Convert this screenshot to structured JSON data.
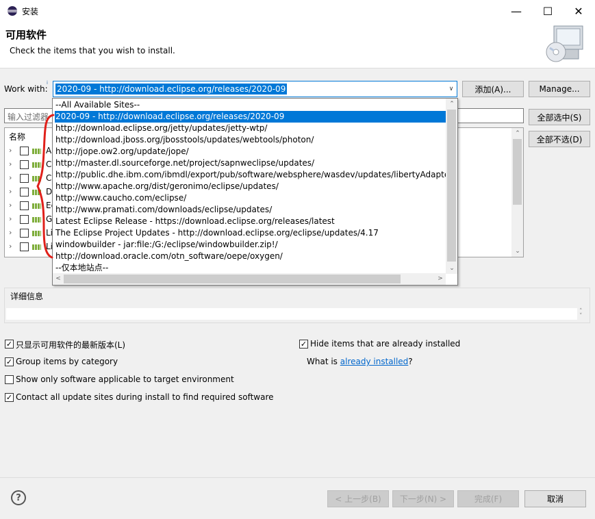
{
  "window": {
    "title": "安装",
    "minimize": "—",
    "maximize": "☐",
    "close": "✕"
  },
  "banner": {
    "title": "可用软件",
    "description": "Check the items that you wish to install."
  },
  "work_with": {
    "label": "Work with:",
    "info_marker": "i",
    "value": "2020-09 - http://download.eclipse.org/releases/2020-09",
    "arrow": "∨",
    "add_button": "添加(A)...",
    "manage_button": "Manage..."
  },
  "dropdown": {
    "items": [
      "--All Available Sites--",
      "2020-09 - http://download.eclipse.org/releases/2020-09",
      "http://download.eclipse.org/jetty/updates/jetty-wtp/",
      "http://download.jboss.org/jbosstools/updates/webtools/photon/",
      "http://jope.ow2.org/update/jope/",
      "http://master.dl.sourceforge.net/project/sapnweclipse/updates/",
      "http://public.dhe.ibm.com/ibmdl/export/pub/software/websphere/wasdev/updates/libertyAdapter/",
      "http://www.apache.org/dist/geronimo/eclipse/updates/",
      "http://www.caucho.com/eclipse/",
      "http://www.pramati.com/downloads/eclipse/updates/",
      "Latest Eclipse Release - https://download.eclipse.org/releases/latest",
      "The Eclipse Project Updates - http://download.eclipse.org/eclipse/updates/4.17",
      "windowbuilder - jar:file:/G:/eclipse/windowbuilder.zip!/",
      "http://download.oracle.com/otn_software/oepe/oxygen/",
      "--仅本地站点--"
    ],
    "selected_index": 1
  },
  "filter": {
    "placeholder": "输入过滤器"
  },
  "side_buttons": {
    "select_all": "全部选中(S)",
    "deselect_all": "全部不选(D)"
  },
  "tree": {
    "header": "名称",
    "rows": [
      "A",
      "Cl",
      "Co",
      "D",
      "Ec",
      "G",
      "Li",
      "Li"
    ]
  },
  "details": {
    "label": "详细信息"
  },
  "options": {
    "show_latest": {
      "label": "只显示可用软件的最新版本(L)",
      "checked": true
    },
    "group_by_category": {
      "label": "Group items by category",
      "checked": true
    },
    "applicable_only": {
      "label": "Show only software applicable to target environment",
      "checked": false
    },
    "contact_sites": {
      "label": "Contact all update sites during install to find required software",
      "checked": true
    },
    "hide_installed": {
      "label": "Hide items that are already installed",
      "checked": true
    },
    "what_is_prefix": "What is ",
    "what_is_link": "already installed",
    "what_is_suffix": "?"
  },
  "footer": {
    "help": "?",
    "back": "< 上一步(B)",
    "next": "下一步(N) >",
    "finish": "完成(F)",
    "cancel": "取消"
  },
  "scroll_arrows": {
    "up": "⌃",
    "down": "⌄",
    "left": "<",
    "right": ">"
  },
  "colors": {
    "selection": "#0078d7",
    "link": "#0066cc",
    "annotation": "#e0201a"
  }
}
